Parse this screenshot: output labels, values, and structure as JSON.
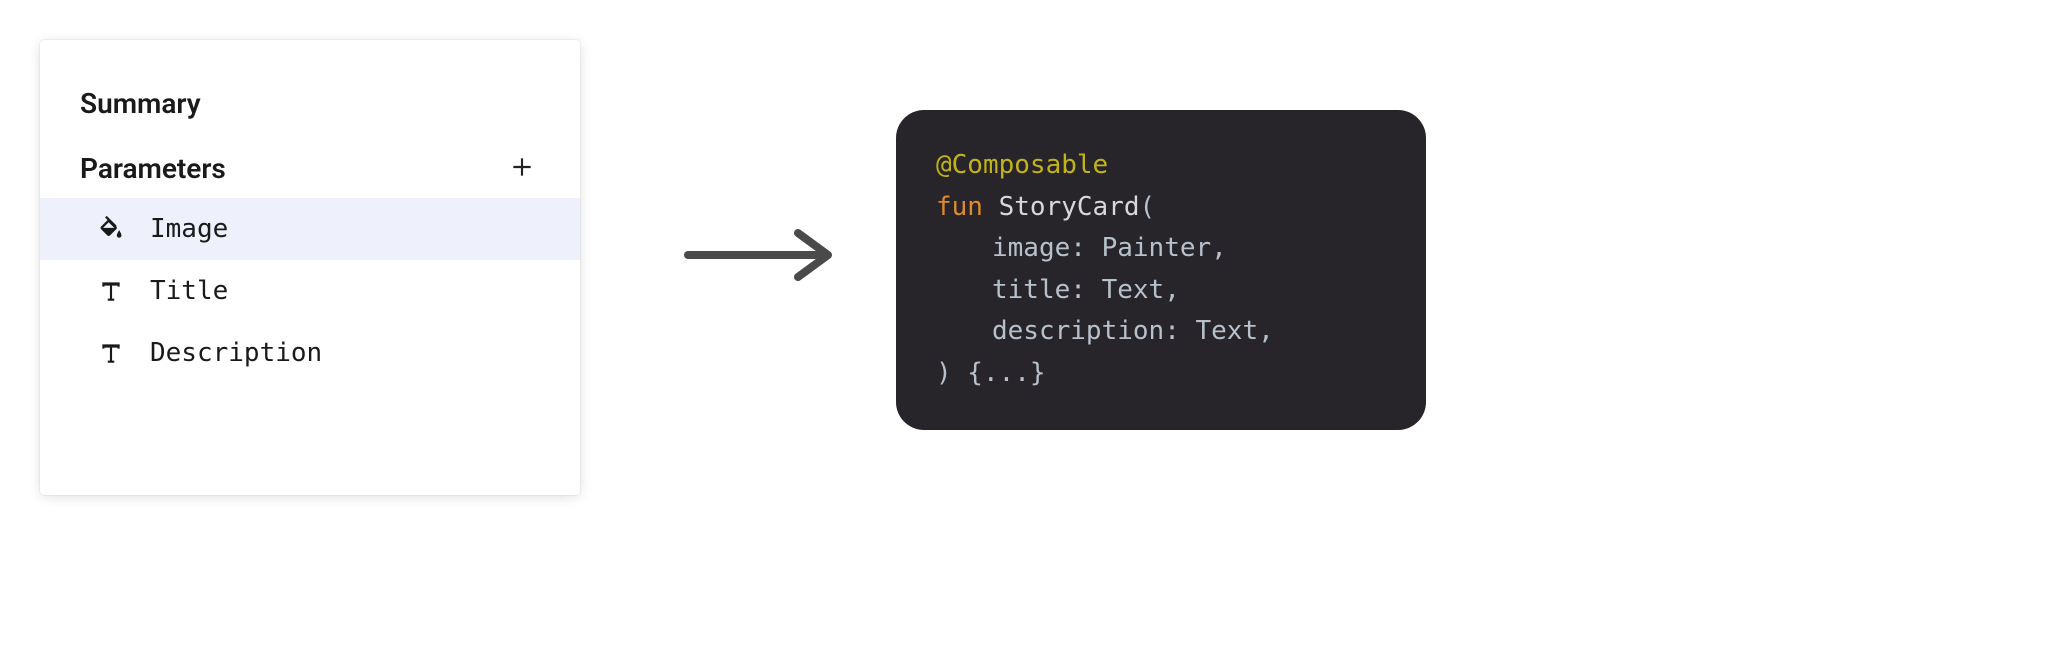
{
  "panel": {
    "summary_title": "Summary",
    "parameters_title": "Parameters",
    "items": [
      {
        "label": "Image",
        "icon": "fill-icon",
        "selected": true
      },
      {
        "label": "Title",
        "icon": "text-icon",
        "selected": false
      },
      {
        "label": "Description",
        "icon": "text-icon",
        "selected": false
      }
    ]
  },
  "code": {
    "annotation": "@Composable",
    "keyword": "fun",
    "function_name": "StoryCard",
    "open": "(",
    "params": [
      {
        "name": "image",
        "type": "Painter"
      },
      {
        "name": "title",
        "type": "Text"
      },
      {
        "name": "description",
        "type": "Text"
      }
    ],
    "close_line": ") {...}"
  }
}
